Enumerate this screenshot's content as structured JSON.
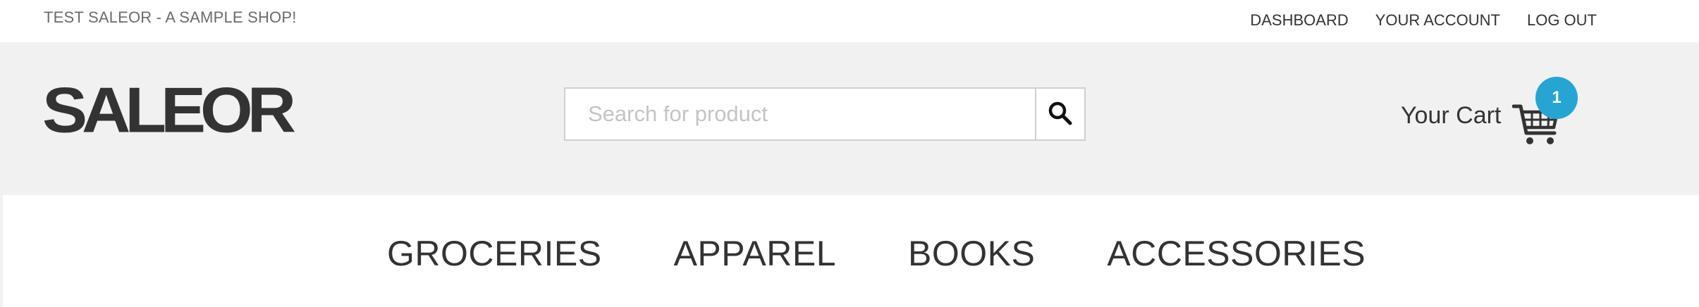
{
  "topbar": {
    "shop_name": "TEST SALEOR - A SAMPLE SHOP!",
    "links": [
      "DASHBOARD",
      "YOUR ACCOUNT",
      "LOG OUT"
    ]
  },
  "header": {
    "logo_text": "SALEOR",
    "search": {
      "placeholder": "Search for product",
      "value": ""
    },
    "cart": {
      "label": "Your Cart",
      "count": "1"
    }
  },
  "nav": {
    "categories": [
      "GROCERIES",
      "APPAREL",
      "BOOKS",
      "ACCESSORIES"
    ]
  },
  "colors": {
    "header_bg": "#f1f1f1",
    "text": "#333333",
    "muted_text": "#6b6b6b",
    "badge": "#26a5d4",
    "border": "#cfcfcf"
  },
  "icons": {
    "search": "search-icon",
    "cart": "shopping-cart-icon"
  }
}
